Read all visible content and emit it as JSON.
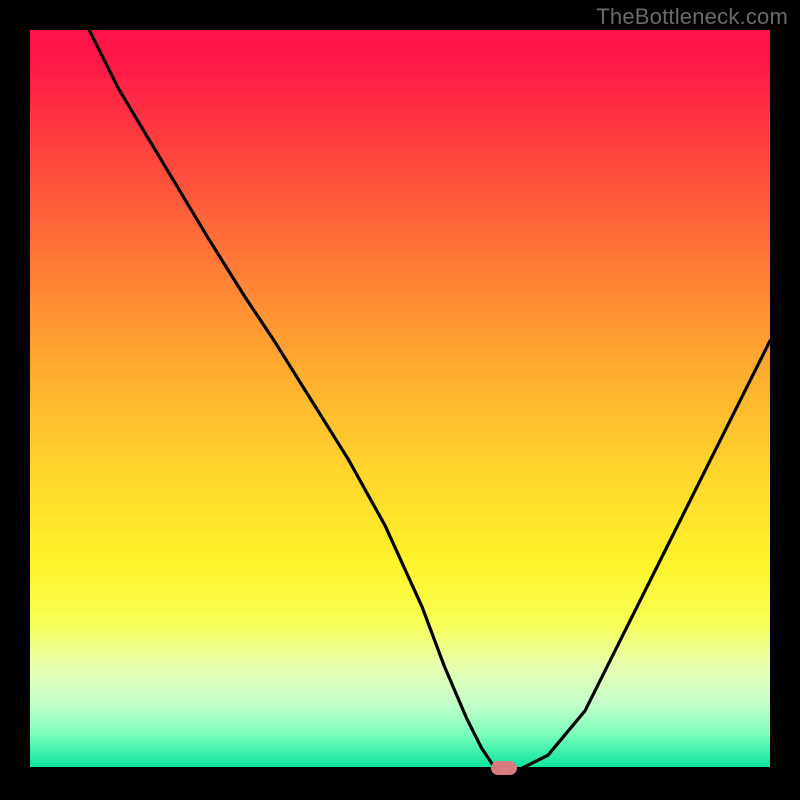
{
  "watermark": "TheBottleneck.com",
  "chart_data": {
    "type": "line",
    "title": "",
    "xlabel": "",
    "ylabel": "",
    "xlim": [
      0,
      100
    ],
    "ylim": [
      0,
      100
    ],
    "grid": false,
    "legend": false,
    "background": "rainbow-gradient red-top green-bottom",
    "series": [
      {
        "name": "bottleneck-curve",
        "x": [
          8,
          12,
          18,
          24,
          29,
          33,
          38,
          43,
          48,
          53,
          56,
          59,
          61,
          63,
          66,
          70,
          75,
          80,
          86,
          92,
          100
        ],
        "y": [
          100,
          92,
          82,
          72,
          64,
          58,
          50,
          42,
          33,
          22,
          14,
          7,
          3,
          0,
          0,
          2,
          8,
          18,
          30,
          42,
          58
        ]
      }
    ],
    "annotations": [
      {
        "name": "optimal-marker",
        "x": 64,
        "y": 0,
        "shape": "pill",
        "color": "#d97a7f"
      }
    ]
  }
}
